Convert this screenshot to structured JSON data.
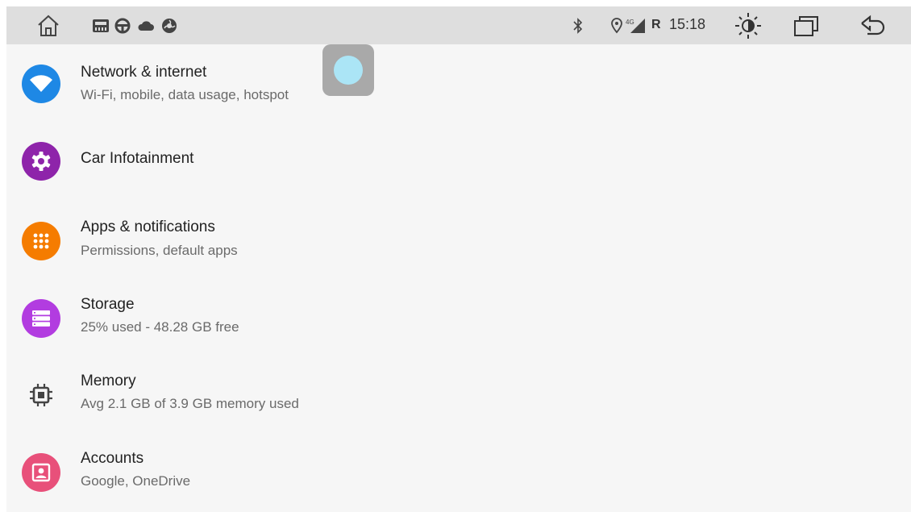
{
  "statusbar": {
    "time": "15:18",
    "network_type": "4G",
    "roaming": "R",
    "icons": [
      "home-icon",
      "radio-app-icon",
      "steering-wheel-icon",
      "cloud-icon",
      "fan-icon",
      "bluetooth-icon",
      "location-icon",
      "signal-icon",
      "brightness-icon",
      "recent-apps-icon",
      "back-icon"
    ]
  },
  "settings": {
    "items": [
      {
        "title": "Network & internet",
        "subtitle": "Wi-Fi, mobile, data usage, hotspot",
        "icon": "wifi-icon",
        "color": "#1e88e5"
      },
      {
        "title": "Car Infotainment",
        "subtitle": "",
        "icon": "gear-icon",
        "color": "#8e24aa"
      },
      {
        "title": "Apps & notifications",
        "subtitle": "Permissions, default apps",
        "icon": "apps-grid-icon",
        "color": "#f57c00"
      },
      {
        "title": "Storage",
        "subtitle": "25% used - 48.28 GB free",
        "icon": "storage-icon",
        "color": "#b23ce0"
      },
      {
        "title": "Memory",
        "subtitle": "Avg 2.1 GB of 3.9 GB memory used",
        "icon": "memory-chip-icon",
        "color": "#555555"
      },
      {
        "title": "Accounts",
        "subtitle": "Google, OneDrive",
        "icon": "account-icon",
        "color": "#e8507a"
      }
    ]
  }
}
